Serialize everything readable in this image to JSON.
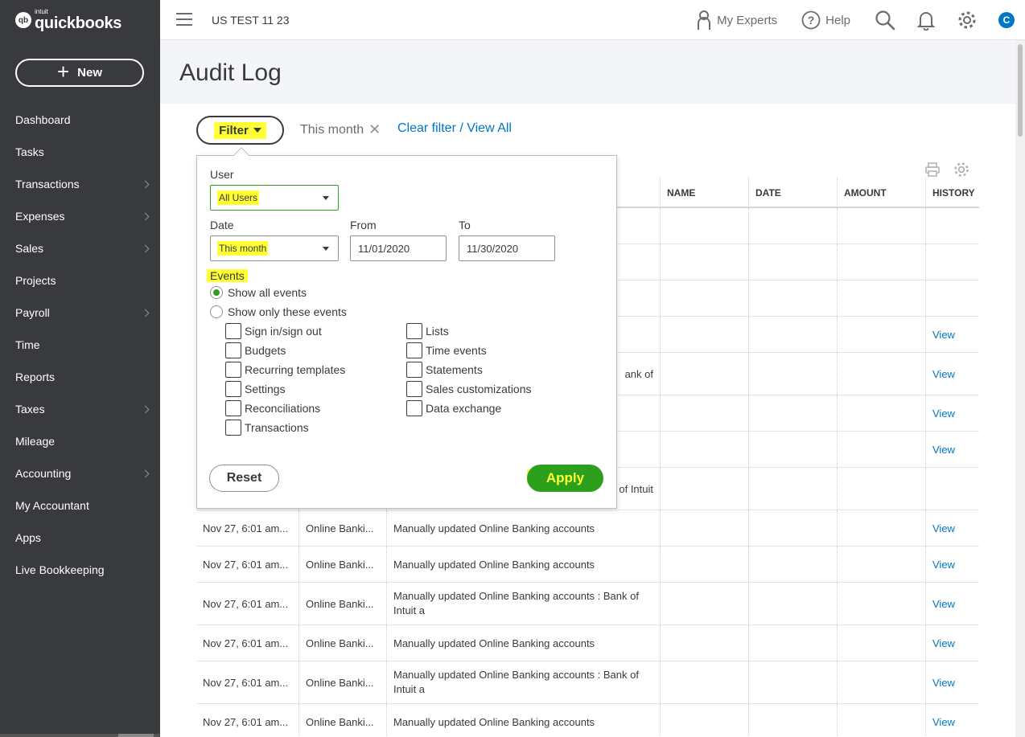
{
  "app": {
    "logo_intuit": "intuit",
    "logo_name": "quickbooks",
    "logo_mark": "qb",
    "new_label": "New"
  },
  "sidebar": {
    "items": [
      {
        "label": "Dashboard",
        "chevron": false
      },
      {
        "label": "Tasks",
        "chevron": false
      },
      {
        "label": "Transactions",
        "chevron": true
      },
      {
        "label": "Expenses",
        "chevron": true
      },
      {
        "label": "Sales",
        "chevron": true
      },
      {
        "label": "Projects",
        "chevron": false
      },
      {
        "label": "Payroll",
        "chevron": true
      },
      {
        "label": "Time",
        "chevron": false
      },
      {
        "label": "Reports",
        "chevron": false
      },
      {
        "label": "Taxes",
        "chevron": true
      },
      {
        "label": "Mileage",
        "chevron": false
      },
      {
        "label": "Accounting",
        "chevron": true
      },
      {
        "label": "My Accountant",
        "chevron": false
      },
      {
        "label": "Apps",
        "chevron": false
      },
      {
        "label": "Live Bookkeeping",
        "chevron": false
      }
    ]
  },
  "topbar": {
    "company": "US TEST 11 23",
    "my_experts": "My Experts",
    "help": "Help",
    "avatar_initial": "C"
  },
  "page": {
    "title": "Audit Log"
  },
  "filterbar": {
    "filter_label": "Filter",
    "chip_label": "This month",
    "clear_link": "Clear filter / View All"
  },
  "table": {
    "headers": {
      "name": "NAME",
      "date": "DATE",
      "amount": "AMOUNT",
      "history": "HISTORY"
    },
    "hidden_rows": [
      {
        "desc_tail": "",
        "link": ""
      },
      {
        "desc_tail": "",
        "link": ""
      },
      {
        "desc_tail": "",
        "link": ""
      },
      {
        "desc_tail": "",
        "link": "View"
      },
      {
        "desc_tail": "ank of",
        "link": "View"
      },
      {
        "desc_tail": "",
        "link": "View"
      },
      {
        "desc_tail": "",
        "link": "View"
      },
      {
        "desc_tail": "of Intuit",
        "link": ""
      }
    ],
    "rows": [
      {
        "date": "Nov 27, 6:01 am...",
        "user": "Online Banki...",
        "event": "Manually updated Online Banking accounts",
        "link": "View"
      },
      {
        "date": "Nov 27, 6:01 am...",
        "user": "Online Banki...",
        "event": "Manually updated Online Banking accounts",
        "link": "View"
      },
      {
        "date": "Nov 27, 6:01 am...",
        "user": "Online Banki...",
        "event": "Manually updated Online Banking accounts : Bank of Intuit a",
        "link": "View"
      },
      {
        "date": "Nov 27, 6:01 am...",
        "user": "Online Banki...",
        "event": "Manually updated Online Banking accounts",
        "link": "View"
      },
      {
        "date": "Nov 27, 6:01 am...",
        "user": "Online Banki...",
        "event": "Manually updated Online Banking accounts : Bank of Intuit a",
        "link": "View"
      },
      {
        "date": "Nov 27, 6:01 am...",
        "user": "Online Banki...",
        "event": "Manually updated Online Banking accounts",
        "link": "View"
      }
    ]
  },
  "filter_panel": {
    "user_label": "User",
    "user_value": "All Users",
    "date_label": "Date",
    "date_value": "This month",
    "from_label": "From",
    "from_value": "11/01/2020",
    "to_label": "To",
    "to_value": "11/30/2020",
    "events_label": "Events",
    "show_all": "Show all events",
    "show_only": "Show only these events",
    "events_left": [
      "Sign in/sign out",
      "Budgets",
      "Recurring templates",
      "Settings",
      "Reconciliations",
      "Transactions"
    ],
    "events_right": [
      "Lists",
      "Time events",
      "Statements",
      "Sales customizations",
      "Data exchange"
    ],
    "reset_label": "Reset",
    "apply_label": "Apply"
  },
  "colors": {
    "sidebar_bg": "#393a3d",
    "accent_green": "#2ca01c",
    "link_blue": "#0077c5",
    "highlight_yellow": "#ffff33"
  }
}
